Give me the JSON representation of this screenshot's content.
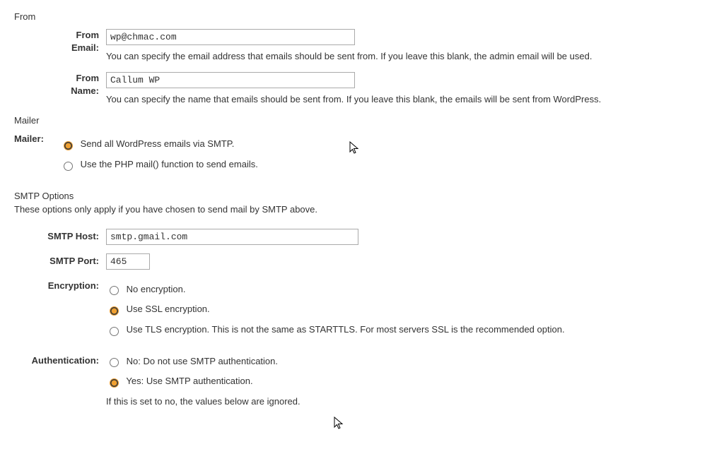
{
  "from_section": {
    "legend": "From",
    "email": {
      "label_line1": "From",
      "label_line2": "Email:",
      "value": "wp@chmac.com",
      "desc": "You can specify the email address that emails should be sent from. If you leave this blank, the admin email will be used."
    },
    "name": {
      "label_line1": "From",
      "label_line2": "Name:",
      "value": "Callum WP",
      "desc": "You can specify the name that emails should be sent from. If you leave this blank, the emails will be sent from WordPress."
    }
  },
  "mailer_section": {
    "legend": "Mailer",
    "label": "Mailer:",
    "options": {
      "smtp": "Send all WordPress emails via SMTP.",
      "php": "Use the PHP mail() function to send emails."
    },
    "selected": "smtp"
  },
  "smtp_section": {
    "legend": "SMTP Options",
    "note": "These options only apply if you have chosen to send mail by SMTP above.",
    "host": {
      "label": "SMTP Host:",
      "value": "smtp.gmail.com"
    },
    "port": {
      "label": "SMTP Port:",
      "value": "465"
    },
    "encryption": {
      "label": "Encryption:",
      "options": {
        "none": "No encryption.",
        "ssl": "Use SSL encryption.",
        "tls": "Use TLS encryption. This is not the same as STARTTLS. For most servers SSL is the recommended option."
      },
      "selected": "ssl"
    },
    "auth": {
      "label": "Authentication:",
      "options": {
        "no": "No: Do not use SMTP authentication.",
        "yes": "Yes: Use SMTP authentication."
      },
      "selected": "yes",
      "hint": "If this is set to no, the values below are ignored."
    }
  }
}
